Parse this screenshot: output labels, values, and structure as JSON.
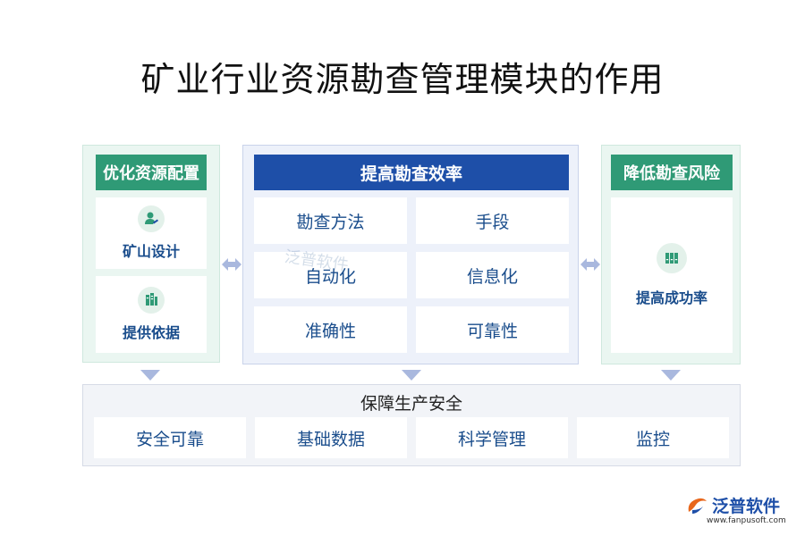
{
  "title": "矿业行业资源勘查管理模块的作用",
  "left": {
    "header": "优化资源配置",
    "items": [
      {
        "label": "矿山设计",
        "icon": "user-edit-icon"
      },
      {
        "label": "提供依据",
        "icon": "database-icon"
      }
    ]
  },
  "center": {
    "header": "提高勘查效率",
    "cells": [
      "勘查方法",
      "手段",
      "自动化",
      "信息化",
      "准确性",
      "可靠性"
    ]
  },
  "right": {
    "header": "降低勘查风险",
    "item": {
      "label": "提高成功率",
      "icon": "binders-icon"
    }
  },
  "bottom": {
    "title": "保障生产安全",
    "cells": [
      "安全可靠",
      "基础数据",
      "科学管理",
      "监控"
    ]
  },
  "brand": {
    "name": "泛普软件",
    "url": "www.fanpusoft.com",
    "watermark": "泛普软件"
  },
  "colors": {
    "green": "#2f9a76",
    "blue": "#1e4fa8",
    "text_blue": "#1a4d8c",
    "arrow": "#a9b8de"
  }
}
